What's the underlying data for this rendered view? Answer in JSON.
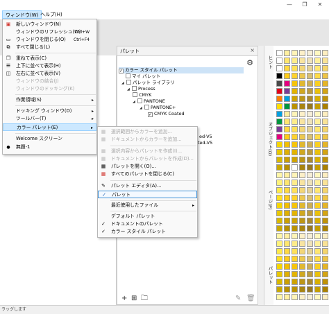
{
  "menubar": {
    "window": "ウィンドウ(W)",
    "help": "ヘルプ(H)"
  },
  "window_menu": {
    "items": [
      {
        "label": "新しいウィンドウ(N)",
        "shortcut": ""
      },
      {
        "label": "ウィンドウのリフレッシュ(W)",
        "shortcut": "Ctrl+W"
      },
      {
        "label": "ウィンドウを閉じる(O)",
        "shortcut": "Ctrl+F4"
      },
      {
        "label": "すべて閉じる(L)",
        "shortcut": ""
      },
      {
        "label": "重ねて表示(C)",
        "shortcut": ""
      },
      {
        "label": "上下に並べて表示(H)",
        "shortcut": ""
      },
      {
        "label": "左右に並べて表示(V)",
        "shortcut": ""
      },
      {
        "label": "ウィンドウの結合(J)",
        "shortcut": ""
      },
      {
        "label": "ウィンドウのドッキング(K)",
        "shortcut": ""
      },
      {
        "label": "作業領域(S)",
        "shortcut": ""
      },
      {
        "label": "ドッキング ウィンドウ(D)",
        "shortcut": ""
      },
      {
        "label": "ツールバー(T)",
        "shortcut": ""
      },
      {
        "label": "カラー パレット(E)",
        "shortcut": ""
      },
      {
        "label": "Welcome スクリーン",
        "shortcut": ""
      },
      {
        "label": "無題-1",
        "shortcut": ""
      }
    ]
  },
  "palette_submenu": {
    "items": [
      "選択範囲からカラーを追加...",
      "ドキュメントからカラーを追加...",
      "選択内容からパレットを作成(I)...",
      "ドキュメントからパレットを作成(D)...",
      "パレットを開く(O)...",
      "すべてのパレットを閉じる(C)",
      "パレット エディタ(A)...",
      "パレット",
      "最近使用したファイル",
      "デフォルト パレット",
      "ドキュメントのパレット",
      "カラー スタイル パレット"
    ]
  },
  "docker": {
    "title": "パレット",
    "close": "×",
    "tree": [
      "カラー スタイル パレット",
      "マイ パレット",
      "パレット ライブラリ",
      "Process",
      "CMYK",
      "PANTONE",
      "PANTONE+",
      "CMYK Coated"
    ],
    "bg_items": [
      "ed-V5",
      "ated-V5"
    ]
  },
  "side_tabs": [
    "ヒント",
    "オブジェクト(O)",
    "ページ(P)",
    "パレット"
  ],
  "status": "ラッグします",
  "colors": {
    "accent": "#cce8ff",
    "accent_border": "#99d1ff",
    "check_blue": "#1b5fb5",
    "icon_red": "#d0342c"
  }
}
